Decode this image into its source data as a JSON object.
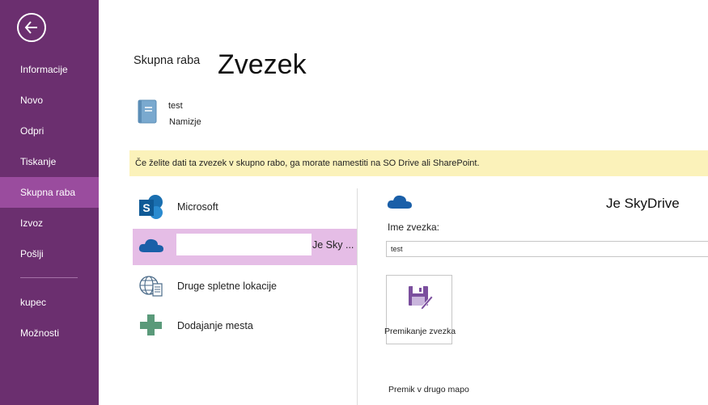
{
  "sidebar": {
    "back_icon": "back-arrow-icon",
    "items": [
      {
        "label": "Informacije"
      },
      {
        "label": "Novo"
      },
      {
        "label": "Odpri"
      },
      {
        "label": "Tiskanje"
      },
      {
        "label": "Skupna raba"
      },
      {
        "label": "Izvoz"
      },
      {
        "label": "Pošlji"
      },
      {
        "label": "kupec"
      },
      {
        "label": "Možnosti"
      }
    ],
    "active_item": "Skupna raba",
    "bg_color": "#6b2f6f",
    "active_color": "#9a4c9e"
  },
  "header": {
    "breadcrumb": "Skupna raba",
    "title": "Zvezek"
  },
  "notebook": {
    "icon": "notebook-icon",
    "name": "test",
    "location": "Namizje"
  },
  "warning": {
    "text": "Če želite dati ta zvezek v skupno rabo, ga morate namestiti na SO Drive ali SharePoint.",
    "bg_color": "#fbf2ba"
  },
  "locations": [
    {
      "label": "Microsoft",
      "icon": "sharepoint-icon"
    },
    {
      "label": "Je Sky ...",
      "icon": "skydrive-cloud-icon",
      "selected": true
    },
    {
      "label": "Druge spletne lokacije",
      "icon": "globe-document-icon"
    },
    {
      "label": "Dodajanje mesta",
      "icon": "plus-icon"
    }
  ],
  "right_panel": {
    "cloud_icon": "skydrive-cloud-icon",
    "title": "Je SkyDrive",
    "name_label": "Ime zvezka:",
    "name_value": "test",
    "move_button_label": "Premikanje zvezka",
    "move_button_icon": "save-edit-icon",
    "move_link": "Premik v drugo mapo"
  }
}
